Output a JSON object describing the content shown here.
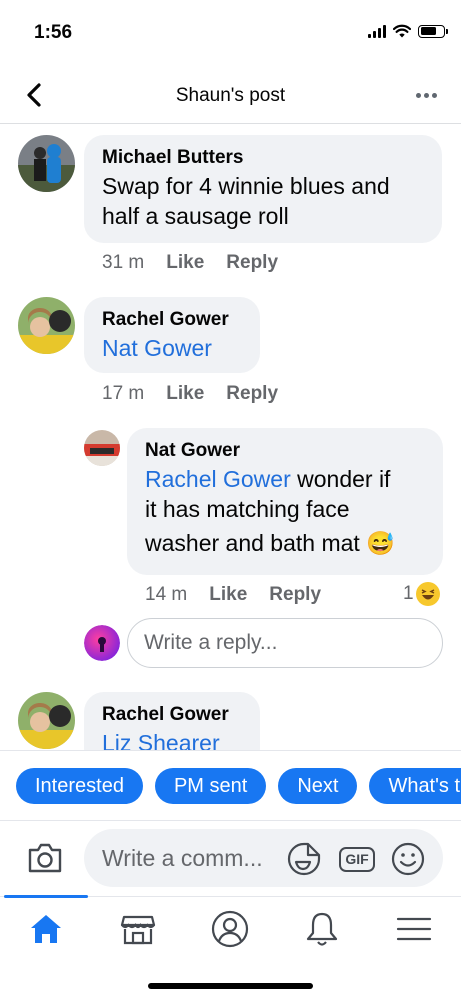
{
  "status_bar": {
    "time": "1:56"
  },
  "header": {
    "title": "Shaun's post",
    "back_icon": "chevron-left-icon",
    "more_icon": "more-horizontal-icon"
  },
  "comments": [
    {
      "name": "Michael Butters",
      "text_line1": "Swap for 4 winnie blues and",
      "text_line2": "half a sausage roll",
      "time": "31 m",
      "like": "Like",
      "reply": "Reply"
    },
    {
      "name": "Rachel Gower",
      "mention": "Nat Gower",
      "time": "17 m",
      "like": "Like",
      "reply": "Reply"
    },
    {
      "name": "Nat Gower",
      "mention": "Rachel Gower",
      "text_line1_rest": " wonder if",
      "text_line2": "it has matching face",
      "text_line3": "washer and bath mat",
      "emoji": "😅",
      "time": "14 m",
      "like": "Like",
      "reply": "Reply",
      "reaction_count": "1"
    },
    {
      "name": "Rachel Gower",
      "mention": "Liz Shearer"
    }
  ],
  "reply_box": {
    "placeholder": "Write a reply..."
  },
  "quick_replies": [
    "Interested",
    "PM sent",
    "Next",
    "What's t"
  ],
  "composer": {
    "placeholder": "Write a comm...",
    "gif_label": "GIF"
  },
  "colors": {
    "accent": "#1877f2",
    "mention": "#216fdb",
    "bubble": "#f0f2f5",
    "meta": "#65676b"
  },
  "bottom_nav": [
    "home-icon",
    "marketplace-icon",
    "profile-icon",
    "notifications-icon",
    "menu-icon"
  ]
}
